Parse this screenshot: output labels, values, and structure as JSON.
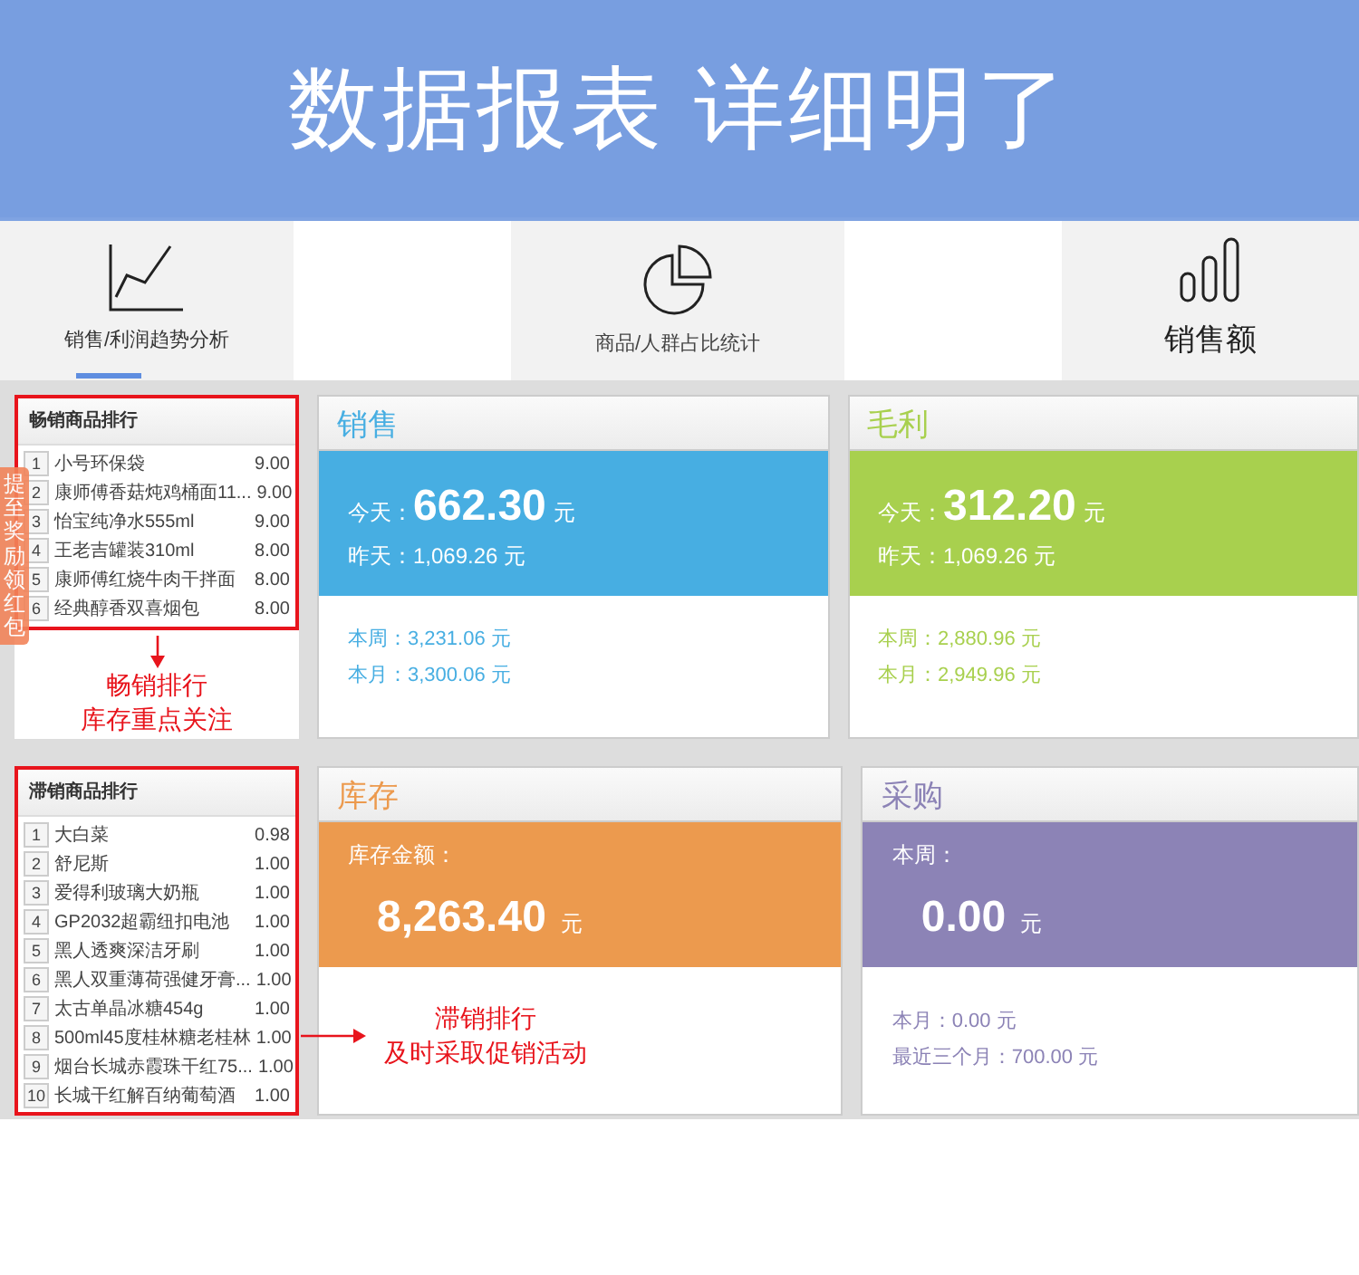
{
  "banner": {
    "title": "**数据报表** 详细明了"
  },
  "tabs": [
    {
      "label": "销售/利润趋势分析",
      "kind": "line",
      "selected": true
    },
    {
      "label": "商品/人群占比统计",
      "kind": "pie",
      "selected": false
    },
    {
      "label": "销售额",
      "kind": "bars",
      "selected": false
    }
  ],
  "side_tab": {
    "label": "提至奖励领红包"
  },
  "rankings": [
    {
      "title": "畅销商品排行",
      "highlighted": true,
      "items": [
        {
          "rank": "1",
          "name": "小号环保袋",
          "value": "9.00"
        },
        {
          "rank": "2",
          "name": "康师傅香菇炖鸡桶面11...",
          "value": "9.00"
        },
        {
          "rank": "3",
          "name": "怡宝纯净水555ml",
          "value": "9.00"
        },
        {
          "rank": "4",
          "name": "王老吉罐装310ml",
          "value": "8.00"
        },
        {
          "rank": "5",
          "name": "康师傅红烧牛肉干拌面",
          "value": "8.00"
        },
        {
          "rank": "6",
          "name": "经典醇香双喜烟包",
          "value": "8.00"
        }
      ],
      "note": {
        "kind": "below",
        "lines": [
          "畅销排行",
          "库存重点关注"
        ]
      }
    },
    {
      "title": "滞销商品排行",
      "highlighted": true,
      "items": [
        {
          "rank": "1",
          "name": "大白菜",
          "value": "0.98"
        },
        {
          "rank": "2",
          "name": "舒尼斯",
          "value": "1.00"
        },
        {
          "rank": "3",
          "name": "爱得利玻璃大奶瓶",
          "value": "1.00"
        },
        {
          "rank": "4",
          "name": "GP2032超霸纽扣电池",
          "value": "1.00"
        },
        {
          "rank": "5",
          "name": "黑人透爽深洁牙刷",
          "value": "1.00"
        },
        {
          "rank": "6",
          "name": "黑人双重薄荷强健牙膏...",
          "value": "1.00"
        },
        {
          "rank": "7",
          "name": "太古单晶冰糖454g",
          "value": "1.00"
        },
        {
          "rank": "8",
          "name": "500ml45度桂林糖老桂林",
          "value": "1.00"
        },
        {
          "rank": "9",
          "name": "烟台长城赤霞珠干红75...",
          "value": "1.00"
        },
        {
          "rank": "10",
          "name": "长城干红解百纳葡萄酒",
          "value": "1.00"
        }
      ],
      "note": {
        "kind": "right",
        "lines": [
          "滞销排行",
          "及时采取促销活动"
        ]
      }
    }
  ],
  "cards": [
    {
      "kind": "daily",
      "title": "销售",
      "color": "#47aee2",
      "label": "今天：",
      "value": "662.30",
      "unit": "元",
      "sub": "昨天：1,069.26 元",
      "lines": [
        "本周：3,231.06 元",
        "本月：3,300.06 元"
      ]
    },
    {
      "kind": "daily",
      "title": "毛利",
      "color": "#a8d04e",
      "label": "今天：",
      "value": "312.20",
      "unit": "元",
      "sub": "昨天：1,069.26 元",
      "lines": [
        "本周：2,880.96 元",
        "本月：2,949.96 元"
      ]
    },
    {
      "kind": "amount",
      "title": "库存",
      "color": "#ec9a4e",
      "label": "库存金额：",
      "value": "8,263.40",
      "unit": "元"
    },
    {
      "kind": "amount",
      "title": "采购",
      "color": "#8c83b6",
      "label": "本周：",
      "value": "0.00",
      "unit": "元",
      "lines": [
        "本月：0.00 元",
        "最近三个月：700.00 元"
      ]
    }
  ]
}
